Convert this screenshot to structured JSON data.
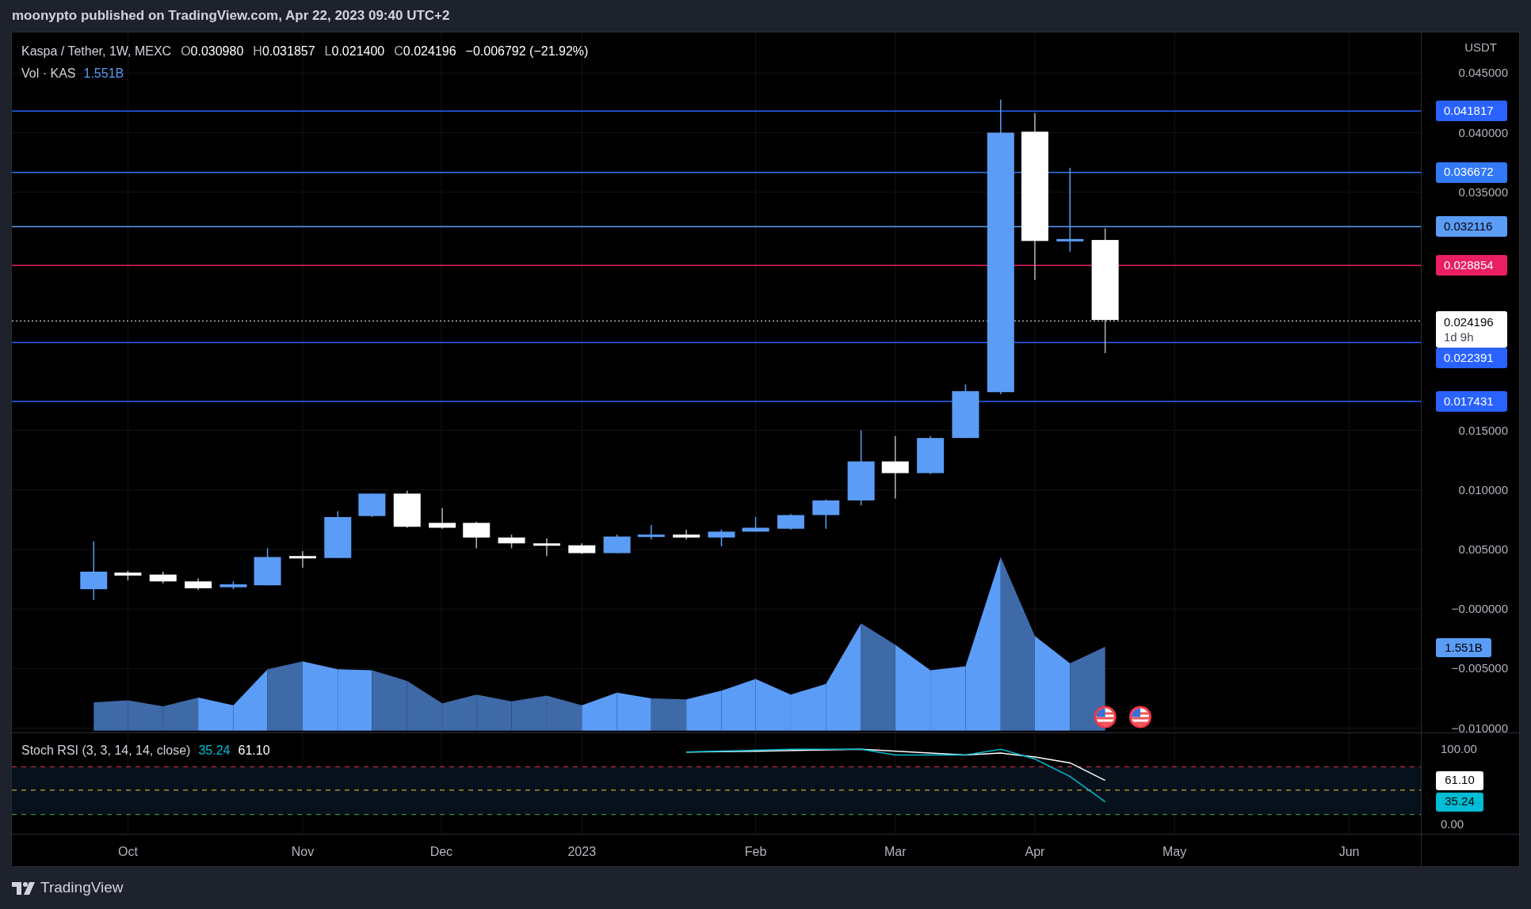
{
  "header": {
    "text": "moonypto published on TradingView.com, Apr 22, 2023 09:40 UTC+2"
  },
  "legend": {
    "symbol": "Kaspa / Tether, 1W, MEXC",
    "ohlc": [
      {
        "label": "O",
        "value": "0.030980"
      },
      {
        "label": "H",
        "value": "0.031857"
      },
      {
        "label": "L",
        "value": "0.021400"
      },
      {
        "label": "C",
        "value": "0.024196"
      }
    ],
    "change": "−0.006792 (−21.92%)"
  },
  "volume_legend": {
    "label": "Vol · KAS",
    "value": "1.551B"
  },
  "price_axis": {
    "unit": "USDT",
    "ticks": [
      "0.045000",
      "0.040000",
      "0.035000",
      "0.015000",
      "0.010000",
      "0.005000",
      "−0.000000",
      "−0.005000",
      "−0.010000"
    ]
  },
  "price_levels": [
    {
      "price": "0.041817",
      "color": "#2962ff"
    },
    {
      "price": "0.036672",
      "color": "#3179f5"
    },
    {
      "price": "0.032116",
      "color": "#5b9cf6"
    },
    {
      "price": "0.028854",
      "color": "#e91e63"
    },
    {
      "price": "0.022391",
      "color": "#2962ff"
    },
    {
      "price": "0.017431",
      "color": "#2962ff"
    }
  ],
  "last_price": {
    "price": "0.024196",
    "countdown": "1d 9h"
  },
  "volume_label": "1.551B",
  "stoch_rsi": {
    "title": "Stoch RSI (3, 3, 14, 14, close)",
    "k": "35.24",
    "d": "61.10",
    "ticks": [
      "100.00",
      "0.00"
    ],
    "d_label": "61.10",
    "k_label": "35.24"
  },
  "time_axis": [
    "Oct",
    "Nov",
    "Dec",
    "2023",
    "Feb",
    "Mar",
    "Apr",
    "May",
    "Jun"
  ],
  "footer": {
    "brand": "TradingView"
  }
}
